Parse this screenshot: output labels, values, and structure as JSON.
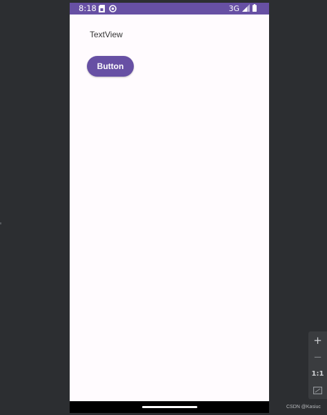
{
  "status_bar": {
    "time": "8:18",
    "network": "3G",
    "icons": [
      "sim-card-icon",
      "media-icon",
      "signal-icon",
      "battery-icon"
    ]
  },
  "app": {
    "text_view": "TextView",
    "button_label": "Button"
  },
  "zoom_controls": {
    "zoom_in_label": "+",
    "zoom_out_label": "−",
    "actual_size_label": "1:1",
    "fit_icon": "fit-screen-icon"
  },
  "watermark": "CSDN @Kasiuc",
  "colors": {
    "primary": "#6750a4",
    "surface": "#fffbfe",
    "workspace": "#2c2e31"
  }
}
